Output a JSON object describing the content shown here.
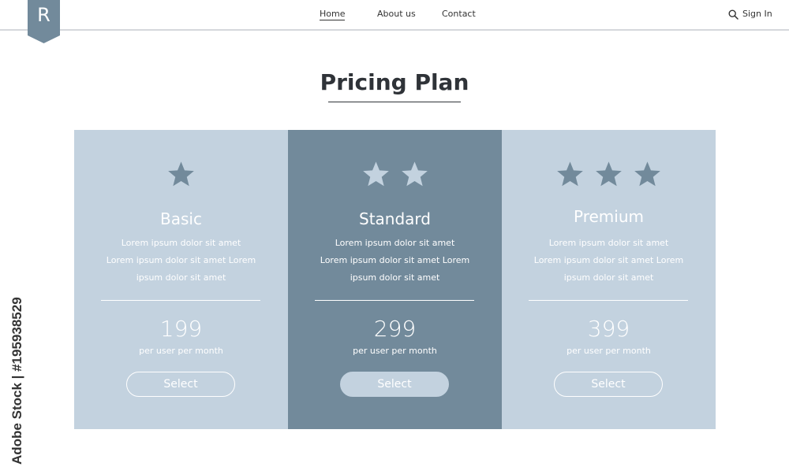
{
  "logo": {
    "letter": "R"
  },
  "nav": {
    "home": "Home",
    "about": "About us",
    "contact": "Contact"
  },
  "header": {
    "sign_in": "Sign In",
    "search_icon": "search-icon"
  },
  "page_title": "Pricing Plan",
  "colors": {
    "card_light": "#c3d2df",
    "card_dark": "#728a9b",
    "star_dark": "#728a9b",
    "star_light": "#c3d2df",
    "logo": "#728a9b"
  },
  "plans": [
    {
      "name": "Basic",
      "stars": 1,
      "description_lines": [
        "Lorem ipsum dolor sit amet",
        "Lorem ipsum dolor sit amet Lorem",
        "ipsum dolor sit amet"
      ],
      "price": "199",
      "period": "per user per month",
      "button": "Select"
    },
    {
      "name": "Standard",
      "stars": 2,
      "description_lines": [
        "Lorem ipsum dolor sit amet",
        "Lorem ipsum dolor sit amet Lorem",
        "ipsum dolor sit amet"
      ],
      "price": "299",
      "period": "per user per month",
      "button": "Select"
    },
    {
      "name": "Premium",
      "stars": 3,
      "description_lines": [
        "Lorem ipsum dolor sit amet",
        "Lorem ipsum dolor sit amet Lorem",
        "ipsum dolor sit amet"
      ],
      "price": "399",
      "period": "per user per month",
      "button": "Select"
    }
  ],
  "stock_credit": "Adobe Stock | #195938529"
}
